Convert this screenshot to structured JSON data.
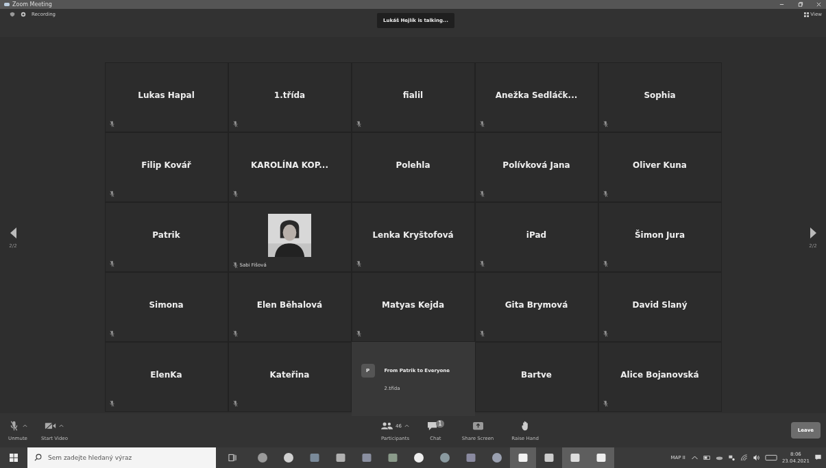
{
  "window": {
    "title": "Zoom Meeting"
  },
  "top_bar": {
    "recording": "Recording",
    "talking": "Lukáš Hejlík is talking...",
    "view": "View"
  },
  "pager": {
    "left": "2/2",
    "right": "2/2"
  },
  "tiles": [
    {
      "kind": "name",
      "name": "Lukas Hapal",
      "muted": true
    },
    {
      "kind": "name",
      "name": "1.třída",
      "muted": true
    },
    {
      "kind": "name",
      "name": "fialil",
      "muted": true
    },
    {
      "kind": "name",
      "name": "Anežka Sedláčk...",
      "muted": true
    },
    {
      "kind": "name",
      "name": "Sophia",
      "muted": true
    },
    {
      "kind": "name",
      "name": "Filip Kovář",
      "muted": true
    },
    {
      "kind": "name",
      "name": "KAROLÍNA KOP...",
      "muted": true
    },
    {
      "kind": "name",
      "name": "Polehla",
      "muted": false
    },
    {
      "kind": "name",
      "name": "Polívková Jana",
      "muted": true
    },
    {
      "kind": "name",
      "name": "Oliver Kuna",
      "muted": true
    },
    {
      "kind": "name",
      "name": "Patrik",
      "muted": true
    },
    {
      "name": "Sabi Fišová",
      "muted": true
    },
    {
      "kind": "name",
      "name": "Lenka Kryštofová",
      "muted": true
    },
    {
      "kind": "name",
      "name": "iPad",
      "muted": true
    },
    {
      "kind": "name",
      "name": "Šimon Jura",
      "muted": true
    },
    {
      "kind": "name",
      "name": "Simona",
      "muted": true
    },
    {
      "kind": "name",
      "name": "Elen Běhalová",
      "muted": true
    },
    {
      "kind": "name",
      "name": "Matyas Kejda",
      "muted": true
    },
    {
      "kind": "name",
      "name": "Gita Brymová",
      "muted": true
    },
    {
      "kind": "name",
      "name": "David Slaný",
      "muted": true
    },
    {
      "kind": "name",
      "name": "ElenKa",
      "muted": true
    },
    {
      "kind": "name",
      "name": "Kateřina",
      "muted": true
    },
    {
      "kind": "chat",
      "avatar": "P",
      "title": "From Patrik to Everyone",
      "message": "2.třída"
    },
    {
      "kind": "name",
      "name": "Bartve",
      "muted": false
    },
    {
      "kind": "name",
      "name": "Alice Bojanovská",
      "muted": true
    }
  ],
  "toolbar": {
    "left": [
      {
        "kind": "mic",
        "label": "Unmute"
      },
      {
        "kind": "video",
        "label": "Start Video"
      }
    ],
    "center": [
      {
        "kind": "participants",
        "label": "Participants",
        "count": "46"
      },
      {
        "kind": "chat",
        "label": "Chat",
        "badge": "1"
      },
      {
        "kind": "share",
        "label": "Share Screen"
      },
      {
        "kind": "hand",
        "label": "Raise Hand"
      }
    ],
    "leave": "Leave"
  },
  "taskbar": {
    "search": {
      "placeholder": "Sem zadejte hledaný výraz"
    },
    "apps": [
      {
        "kind": "chrome",
        "active": false
      },
      {
        "kind": "compass",
        "active": false
      },
      {
        "kind": "outlook",
        "active": false
      },
      {
        "kind": "folder",
        "active": false
      },
      {
        "kind": "word",
        "active": false
      },
      {
        "kind": "excel",
        "active": false
      },
      {
        "kind": "music",
        "active": false
      },
      {
        "kind": "edge",
        "active": false
      },
      {
        "kind": "teams",
        "active": false
      },
      {
        "kind": "skype",
        "active": false
      },
      {
        "kind": "cloud",
        "active": true
      },
      {
        "kind": "notes",
        "active": false
      },
      {
        "kind": "person",
        "active": true
      },
      {
        "kind": "camera",
        "active": true
      }
    ],
    "language": "MAP II",
    "time": "8:06",
    "date": "23.04.2021"
  }
}
